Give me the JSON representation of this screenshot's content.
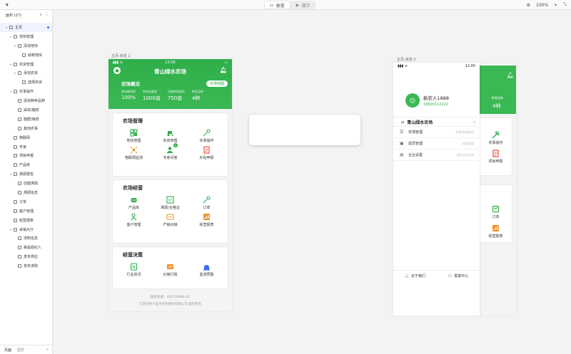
{
  "toolbar": {
    "logo": "墨刀",
    "design_label": "总览",
    "preview_label": "演示",
    "zoom": "100%"
  },
  "left_panel": {
    "header": "画布 (27)",
    "tree": [
      {
        "label": "主页",
        "level": 0,
        "caret": true,
        "selected": true
      },
      {
        "label": "地块管理",
        "level": 1,
        "caret": true
      },
      {
        "label": "添加地块",
        "level": 2,
        "caret": true
      },
      {
        "label": "绘制地块",
        "level": 3,
        "caret": false
      },
      {
        "label": "农资管理",
        "level": 1,
        "caret": true
      },
      {
        "label": "添加农资",
        "level": 2,
        "caret": true
      },
      {
        "label": "选择农资",
        "level": 3,
        "caret": false
      },
      {
        "label": "农事操作",
        "level": 1,
        "caret": true
      },
      {
        "label": "添加种养品种",
        "level": 2,
        "caret": false
      },
      {
        "label": "采收/捕捞",
        "level": 2,
        "caret": false
      },
      {
        "label": "施肥/用药",
        "level": 2,
        "caret": false
      },
      {
        "label": "其他农事",
        "level": 2,
        "caret": false
      },
      {
        "label": "物联网",
        "level": 1,
        "caret": false
      },
      {
        "label": "专家",
        "level": 1,
        "caret": false
      },
      {
        "label": "项目申报",
        "level": 1,
        "caret": false
      },
      {
        "label": "产品库",
        "level": 1,
        "caret": false
      },
      {
        "label": "溯源报告",
        "level": 1,
        "caret": true
      },
      {
        "label": "创建溯源",
        "level": 2,
        "caret": false
      },
      {
        "label": "溯源信息",
        "level": 2,
        "caret": false
      },
      {
        "label": "订单",
        "level": 1,
        "caret": false
      },
      {
        "label": "客户管理",
        "level": 1,
        "caret": false
      },
      {
        "label": "经营报表",
        "level": 1,
        "caret": false
      },
      {
        "label": "采销大厅",
        "level": 1,
        "caret": true
      },
      {
        "label": "求购信息",
        "level": 2,
        "caret": false
      },
      {
        "label": "我是经纪人",
        "level": 2,
        "caret": false
      },
      {
        "label": "发布供应",
        "level": 2,
        "caret": false
      },
      {
        "label": "发布求购",
        "level": 2,
        "caret": false
      }
    ],
    "footer_tab1": "页面",
    "footer_tab2": "图层"
  },
  "frame1": {
    "label": "主页-状态 1",
    "time": "12:00",
    "title": "青山绿水农场",
    "overview_title": "农场概况",
    "map_button": "农场地图",
    "stats": [
      {
        "label": "地块使用率",
        "value": "100%"
      },
      {
        "label": "地块总面积",
        "value": "1000亩"
      },
      {
        "label": "目前种养面积",
        "value": "750亩"
      },
      {
        "label": "种养品种",
        "value": "4种"
      }
    ],
    "sections": [
      {
        "title": "农场管理",
        "items": [
          {
            "label": "地块管理",
            "icon": "plot-icon",
            "color": "#2fae4a"
          },
          {
            "label": "农资管理",
            "icon": "tractor-icon",
            "color": "#2fae4a"
          },
          {
            "label": "农事操作",
            "icon": "tools-icon",
            "color": "#2fae4a"
          },
          {
            "label": "物联网监测",
            "icon": "iot-icon",
            "color": "#f0932b"
          },
          {
            "label": "专家问答",
            "icon": "expert-icon",
            "color": "#2fae4a",
            "badge": "1"
          },
          {
            "label": "补贴申报",
            "icon": "subsidy-icon",
            "color": "#e74c3c"
          }
        ]
      },
      {
        "title": "农场经营",
        "items": [
          {
            "label": "产品库",
            "icon": "product-icon",
            "color": "#2fae4a"
          },
          {
            "label": "溯源/合格证",
            "icon": "trace-icon",
            "color": "#2fae4a"
          },
          {
            "label": "订单",
            "icon": "order-icon",
            "color": "#2fae4a"
          },
          {
            "label": "客户管理",
            "icon": "customer-icon",
            "color": "#2fae4a"
          },
          {
            "label": "产销对接",
            "icon": "match-icon",
            "color": "#f0932b"
          },
          {
            "label": "经营报表",
            "icon": "report-icon",
            "color": "#f0932b"
          }
        ]
      },
      {
        "title": "经营决策",
        "items": [
          {
            "label": "行业资讯",
            "icon": "news-icon",
            "color": "#2fae4a"
          },
          {
            "label": "价格行情",
            "icon": "price-icon",
            "color": "#f0932b"
          },
          {
            "label": "监测预警",
            "icon": "alarm-icon",
            "color": "#3a6bf4"
          }
        ]
      }
    ],
    "hotline": "服务热线：400-16886-03",
    "copyright": "江苏农牧人电子商务股份有限公司 版权所有"
  },
  "frame2": {
    "label": "主页-状态 2",
    "time": "12:00",
    "user_name": "新农人1888",
    "user_phone": "18600112222",
    "farm_name": "青山绿水农场",
    "menu": [
      {
        "label": "农场管理",
        "hint": "切换/新增农场",
        "icon": "list-icon"
      },
      {
        "label": "成员管理",
        "hint": "成员管理",
        "icon": "member-icon"
      },
      {
        "label": "企业设置",
        "hint": "绑定企业信息",
        "icon": "company-icon"
      }
    ],
    "about": "关于我们",
    "help": "帮助中心",
    "behind_stat_label": "种养品种",
    "behind_stat_value": "4种",
    "behind_items": [
      "农事操作",
      "项目申报",
      "订单",
      "经营报表"
    ]
  }
}
